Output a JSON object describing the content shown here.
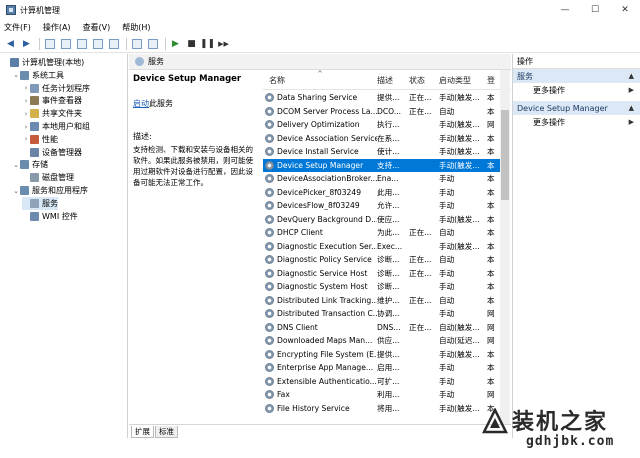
{
  "window": {
    "title": "计算机管理",
    "controls": [
      "—",
      "☐",
      "✕"
    ]
  },
  "menu": [
    "文件(F)",
    "操作(A)",
    "查看(V)",
    "帮助(H)"
  ],
  "toolbar": [
    "◀",
    "▶",
    "▶",
    "■",
    "❚❚",
    "▶▶"
  ],
  "tree": [
    {
      "label": "计算机管理(本地)",
      "level": 0,
      "expander": "",
      "color": "#5b7fa6"
    },
    {
      "label": "系统工具",
      "level": 1,
      "expander": "⌄",
      "color": "#6a8caf"
    },
    {
      "label": "任务计划程序",
      "level": 2,
      "expander": "›",
      "color": "#7e9ab8"
    },
    {
      "label": "事件查看器",
      "level": 2,
      "expander": "›",
      "color": "#8c7a54"
    },
    {
      "label": "共享文件夹",
      "level": 2,
      "expander": "›",
      "color": "#d4b04a"
    },
    {
      "label": "本地用户和组",
      "level": 2,
      "expander": "›",
      "color": "#6d8bb0"
    },
    {
      "label": "性能",
      "level": 2,
      "expander": "›",
      "color": "#c35b3c"
    },
    {
      "label": "设备管理器",
      "level": 2,
      "expander": "",
      "color": "#6b84a6"
    },
    {
      "label": "存储",
      "level": 1,
      "expander": "⌄",
      "color": "#6a8caf"
    },
    {
      "label": "磁盘管理",
      "level": 2,
      "expander": "",
      "color": "#8899aa"
    },
    {
      "label": "服务和应用程序",
      "level": 1,
      "expander": "⌄",
      "color": "#6a8caf"
    },
    {
      "label": "服务",
      "level": 2,
      "expander": "",
      "color": "#8fa3b8",
      "selected": true
    },
    {
      "label": "WMI 控件",
      "level": 2,
      "expander": "",
      "color": "#6d8bb0"
    }
  ],
  "middle": {
    "header": "服务",
    "detail_title": "Device Setup Manager",
    "start_link": "启动",
    "start_suffix": "此服务",
    "desc_label": "描述:",
    "desc_text": "支持检测、下载和安装与设备相关的软件。如果此服务被禁用，则可能使用过期软件对设备进行配置，因此设备可能无法正常工作。",
    "columns": [
      "名称",
      "描述",
      "状态",
      "启动类型",
      "登"
    ],
    "sort_indicator": "^",
    "rows": [
      {
        "name": "Data Sharing Service",
        "desc": "提供...",
        "status": "正在...",
        "start": "手动(触发...",
        "login": "本"
      },
      {
        "name": "DCOM Server Process La...",
        "desc": "DCO...",
        "status": "正在...",
        "start": "自动",
        "login": "本"
      },
      {
        "name": "Delivery Optimization",
        "desc": "执行...",
        "status": "",
        "start": "手动(触发...",
        "login": "网"
      },
      {
        "name": "Device Association Service",
        "desc": "在系...",
        "status": "",
        "start": "手动(触发...",
        "login": "本"
      },
      {
        "name": "Device Install Service",
        "desc": "使计...",
        "status": "",
        "start": "手动(触发...",
        "login": "本"
      },
      {
        "name": "Device Setup Manager",
        "desc": "支持...",
        "status": "",
        "start": "手动(触发...",
        "login": "本",
        "selected": true
      },
      {
        "name": "DeviceAssociationBroker...",
        "desc": "Ena...",
        "status": "",
        "start": "手动",
        "login": "本"
      },
      {
        "name": "DevicePicker_8f03249",
        "desc": "此用...",
        "status": "",
        "start": "手动",
        "login": "本"
      },
      {
        "name": "DevicesFlow_8f03249",
        "desc": "允许...",
        "status": "",
        "start": "手动",
        "login": "本"
      },
      {
        "name": "DevQuery Background D...",
        "desc": "使应...",
        "status": "",
        "start": "手动(触发...",
        "login": "本"
      },
      {
        "name": "DHCP Client",
        "desc": "为此...",
        "status": "正在...",
        "start": "自动",
        "login": "本"
      },
      {
        "name": "Diagnostic Execution Ser...",
        "desc": "Exec...",
        "status": "",
        "start": "手动(触发...",
        "login": "本"
      },
      {
        "name": "Diagnostic Policy Service",
        "desc": "诊断...",
        "status": "正在...",
        "start": "自动",
        "login": "本"
      },
      {
        "name": "Diagnostic Service Host",
        "desc": "诊断...",
        "status": "正在...",
        "start": "手动",
        "login": "本"
      },
      {
        "name": "Diagnostic System Host",
        "desc": "诊断...",
        "status": "",
        "start": "手动",
        "login": "本"
      },
      {
        "name": "Distributed Link Tracking...",
        "desc": "维护...",
        "status": "正在...",
        "start": "自动",
        "login": "本"
      },
      {
        "name": "Distributed Transaction C...",
        "desc": "协调...",
        "status": "",
        "start": "手动",
        "login": "网"
      },
      {
        "name": "DNS Client",
        "desc": "DNS...",
        "status": "正在...",
        "start": "自动(触发...",
        "login": "网"
      },
      {
        "name": "Downloaded Maps Man...",
        "desc": "供应...",
        "status": "",
        "start": "自动(延迟...",
        "login": "网"
      },
      {
        "name": "Encrypting File System (E...",
        "desc": "提供...",
        "status": "",
        "start": "手动(触发...",
        "login": "本"
      },
      {
        "name": "Enterprise App Manage...",
        "desc": "启用...",
        "status": "",
        "start": "手动",
        "login": "本"
      },
      {
        "name": "Extensible Authenticatio...",
        "desc": "可扩...",
        "status": "",
        "start": "手动",
        "login": "本"
      },
      {
        "name": "Fax",
        "desc": "利用...",
        "status": "",
        "start": "手动",
        "login": "网"
      },
      {
        "name": "File History Service",
        "desc": "将用...",
        "status": "",
        "start": "手动(触发...",
        "login": "本"
      }
    ],
    "tabs": [
      "扩展",
      "标准"
    ]
  },
  "actions": {
    "title": "操作",
    "sections": [
      {
        "label": "服务",
        "items": [
          "更多操作"
        ]
      },
      {
        "label": "Device Setup Manager",
        "items": [
          "更多操作"
        ]
      }
    ]
  },
  "watermark": {
    "text": "装机之家",
    "url": "gdhjbk.com"
  }
}
